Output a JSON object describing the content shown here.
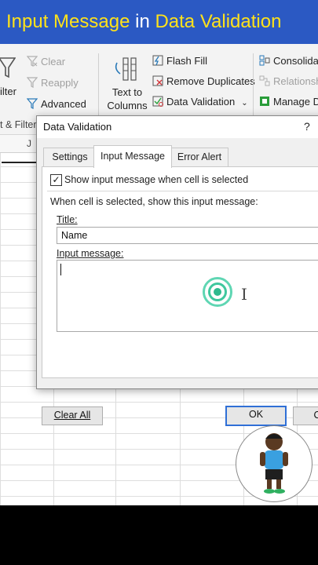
{
  "banner": {
    "part1": "Input Message",
    "part2": " in ",
    "part3": "Data Validation",
    "highlight_color": "#ffe21a",
    "bg_color": "#2b59c3"
  },
  "ribbon": {
    "filter_label": "ilter",
    "clear_label": "Clear",
    "reapply_label": "Reapply",
    "advanced_label": "Advanced",
    "group_sort_filter": "t & Filter",
    "text_to_columns_line1": "Text to",
    "text_to_columns_line2": "Columns",
    "flash_fill": "Flash Fill",
    "remove_duplicates": "Remove Duplicates",
    "data_validation": "Data Validation",
    "consolidate": "Consolida",
    "relationships": "Relationsh",
    "manage_data": "Manage D"
  },
  "sheet": {
    "column_j": "J"
  },
  "dialog": {
    "title": "Data Validation",
    "help": "?",
    "tabs": [
      "Settings",
      "Input Message",
      "Error Alert"
    ],
    "active_tab": "Input Message",
    "show_message_checkbox_label": "Show input message when cell is selected",
    "show_message_checked": true,
    "check_mark": "✓",
    "section_label": "When cell is selected, show this input message:",
    "title_label": "Title:",
    "title_value": "Name",
    "input_message_label": "Input message:",
    "input_message_value": "",
    "clear_all": "Clear All",
    "ok": "OK",
    "cancel": "C"
  }
}
